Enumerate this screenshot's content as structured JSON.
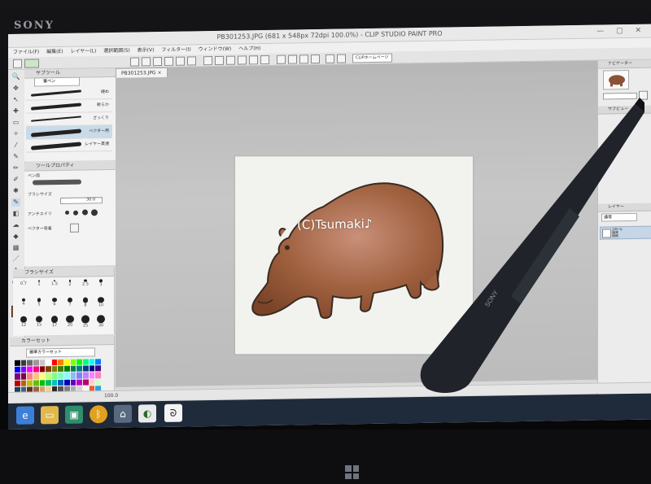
{
  "device": {
    "brand": "SONY"
  },
  "window": {
    "title": "PB301253.JPG (681 x 548px 72dpi 100.0%) - CLIP STUDIO PAINT PRO",
    "controls": "— ▢ ✕"
  },
  "menu": [
    "ファイル(F)",
    "編集(E)",
    "レイヤー(L)",
    "選択範囲(S)",
    "表示(V)",
    "フィルター(I)",
    "ウィンドウ(W)",
    "ヘルプ(H)"
  ],
  "toolbar": {
    "clip_label": "CLIPホームページ"
  },
  "subtool_panel": {
    "title": "サブツール",
    "tab": "筆ペン",
    "brushes": [
      {
        "name": "硬め"
      },
      {
        "name": "軟らか"
      },
      {
        "name": "ざっくり"
      },
      {
        "name": "ベクター用"
      },
      {
        "name": "レイヤー貫通"
      }
    ]
  },
  "tool_property": {
    "title": "ツールプロパティ",
    "brush_label": "ペン用",
    "size_label": "ブラシサイズ",
    "size_value": "30.0",
    "antialias_label": "アンチエイリ",
    "vector_label": "ベクター吸着"
  },
  "brush_size_panel": {
    "title": "ブラシサイズ",
    "sizes": [
      "0.7",
      "1",
      "1.5",
      "2",
      "2.5",
      "3",
      "4",
      "5",
      "6",
      "7",
      "8",
      "10",
      "12",
      "15",
      "17",
      "20",
      "25",
      "30"
    ]
  },
  "color_set": {
    "title": "カラーセット",
    "dropdown": "標準カラーセット",
    "swatches": [
      "#000000",
      "#3a3a3a",
      "#6a6a6a",
      "#9a9a9a",
      "#c8c8c8",
      "#ffffff",
      "#ff0000",
      "#ff8000",
      "#ffff00",
      "#80ff00",
      "#00ff00",
      "#00ff80",
      "#00ffff",
      "#0080ff",
      "#0000ff",
      "#8000ff",
      "#ff00ff",
      "#ff0080",
      "#800000",
      "#804000",
      "#808000",
      "#408000",
      "#008000",
      "#008040",
      "#008080",
      "#004080",
      "#000080",
      "#400080",
      "#800080",
      "#800040",
      "#ff8080",
      "#ffc080",
      "#ffff80",
      "#c0ff80",
      "#80ff80",
      "#80ffc0",
      "#80ffff",
      "#80c0ff",
      "#8080ff",
      "#c080ff",
      "#ff80ff",
      "#ff80c0",
      "#c00000",
      "#c06000",
      "#c0c000",
      "#60c000",
      "#00c000",
      "#00c060",
      "#00c0c0",
      "#0060c0",
      "#0000c0",
      "#6000c0",
      "#c000c0",
      "#c00060",
      "#ffd0d0",
      "#d0ffd0",
      "#204060",
      "#406080",
      "#603020",
      "#a06040",
      "#d0a070",
      "#f0d0a0",
      "#2a2a2a",
      "#555555",
      "#7f7f7f",
      "#aaaaaa",
      "#d4d4d4",
      "#f8f8f8",
      "#e06030",
      "#30a0e0"
    ]
  },
  "document": {
    "tab": "PB301253.JPG",
    "watermark": "(C)Tsumaki♪"
  },
  "navigator": {
    "title": "ナビゲーター"
  },
  "subview": {
    "title": "サブビュー"
  },
  "layer_panel": {
    "title": "レイヤー",
    "blend_mode": "通常",
    "layer_name": "100 %\n通常\n用紙"
  },
  "status": {
    "zoom": "100.0"
  },
  "taskbar": {
    "icons": [
      "ie-icon",
      "folder-icon",
      "app-icon",
      "bluetooth-icon",
      "network-icon",
      "clip-studio-icon",
      "paint-icon"
    ]
  }
}
